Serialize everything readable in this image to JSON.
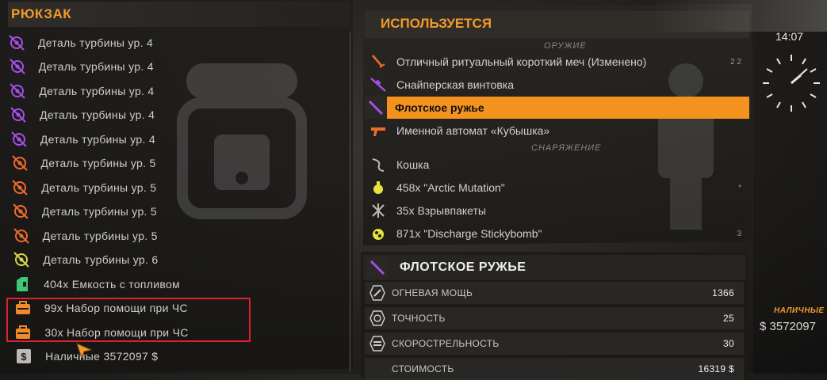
{
  "backpack": {
    "title": "РЮКЗАК",
    "items": [
      {
        "label": "Деталь турбины ур. 4",
        "icon": "turbine-part-icon",
        "color": "#a64ee8"
      },
      {
        "label": "Деталь турбины ур. 4",
        "icon": "turbine-part-icon",
        "color": "#a64ee8"
      },
      {
        "label": "Деталь турбины ур. 4",
        "icon": "turbine-part-icon",
        "color": "#a64ee8"
      },
      {
        "label": "Деталь турбины ур. 4",
        "icon": "turbine-part-icon",
        "color": "#a64ee8"
      },
      {
        "label": "Деталь турбины ур. 4",
        "icon": "turbine-part-icon",
        "color": "#a64ee8"
      },
      {
        "label": "Деталь турбины ур. 5",
        "icon": "turbine-part-icon",
        "color": "#ee6a2b"
      },
      {
        "label": "Деталь турбины ур. 5",
        "icon": "turbine-part-icon",
        "color": "#ee6a2b"
      },
      {
        "label": "Деталь турбины ур. 5",
        "icon": "turbine-part-icon",
        "color": "#ee6a2b"
      },
      {
        "label": "Деталь турбины ур. 5",
        "icon": "turbine-part-icon",
        "color": "#ee6a2b"
      },
      {
        "label": "Деталь турбины ур. 6",
        "icon": "turbine-part-icon",
        "color": "#d9d64a"
      },
      {
        "label": "404х Емкость с топливом",
        "icon": "fuel-canister-icon",
        "color": "#3cc77a"
      },
      {
        "label": "99х Набор помощи при ЧС",
        "icon": "emergency-kit-icon",
        "color": "#f08a2a"
      },
      {
        "label": "30х Набор помощи при ЧС",
        "icon": "emergency-kit-icon",
        "color": "#f08a2a"
      },
      {
        "label": "Наличные 3572097 $",
        "icon": "cash-icon",
        "color": "#bdbab3"
      }
    ]
  },
  "used": {
    "title": "ИСПОЛЬЗУЕТСЯ",
    "weapons_label": "ОРУЖИЕ",
    "gear_label": "СНАРЯЖЕНИЕ",
    "weapons": [
      {
        "label": "Отличный ритуальный короткий меч  (Изменено)",
        "icon": "sword-icon",
        "color": "#ee6a2b",
        "badge": "2 2"
      },
      {
        "label": "Снайперская винтовка",
        "icon": "sniper-rifle-icon",
        "color": "#a64ee8"
      },
      {
        "label": "Флотское ружье",
        "icon": "shotgun-icon",
        "color": "#a64ee8",
        "selected": true
      },
      {
        "label": "Именной автомат «Кубышка»",
        "icon": "rifle-icon",
        "color": "#ee6a2b"
      }
    ],
    "gear": [
      {
        "label": "Кошка",
        "icon": "grappling-hook-icon",
        "color": "#bdbab3"
      },
      {
        "label": "458x \"Arctic Mutation\"",
        "icon": "grenade-icon",
        "color": "#e9e23a",
        "badge": "*"
      },
      {
        "label": "35x Взрывпакеты",
        "icon": "explosive-pack-icon",
        "color": "#bdbab3"
      },
      {
        "label": "871x \"Discharge Stickybomb\"",
        "icon": "stickybomb-icon",
        "color": "#e9e23a",
        "badge": "3"
      }
    ]
  },
  "stats": {
    "title": "ФЛОТСКОЕ РУЖЬЕ",
    "rows": [
      {
        "label": "ОГНЕВАЯ МОЩЬ",
        "value": "1366",
        "icon": "firepower-icon"
      },
      {
        "label": "ТОЧНОСТЬ",
        "value": "25",
        "icon": "accuracy-icon"
      },
      {
        "label": "СКОРОСТРЕЛЬНОСТЬ",
        "value": "30",
        "icon": "rate-of-fire-icon"
      },
      {
        "label": "СТОИМОСТЬ",
        "value": "16319 $",
        "icon": ""
      }
    ]
  },
  "hud": {
    "time": "14:07",
    "cash_label": "НАЛИЧНЫЕ",
    "cash_value": "$ 3572097"
  },
  "colors": {
    "accent": "#f39a2b",
    "selected_row": "#f4921e",
    "highlight_box": "#e0212b"
  }
}
